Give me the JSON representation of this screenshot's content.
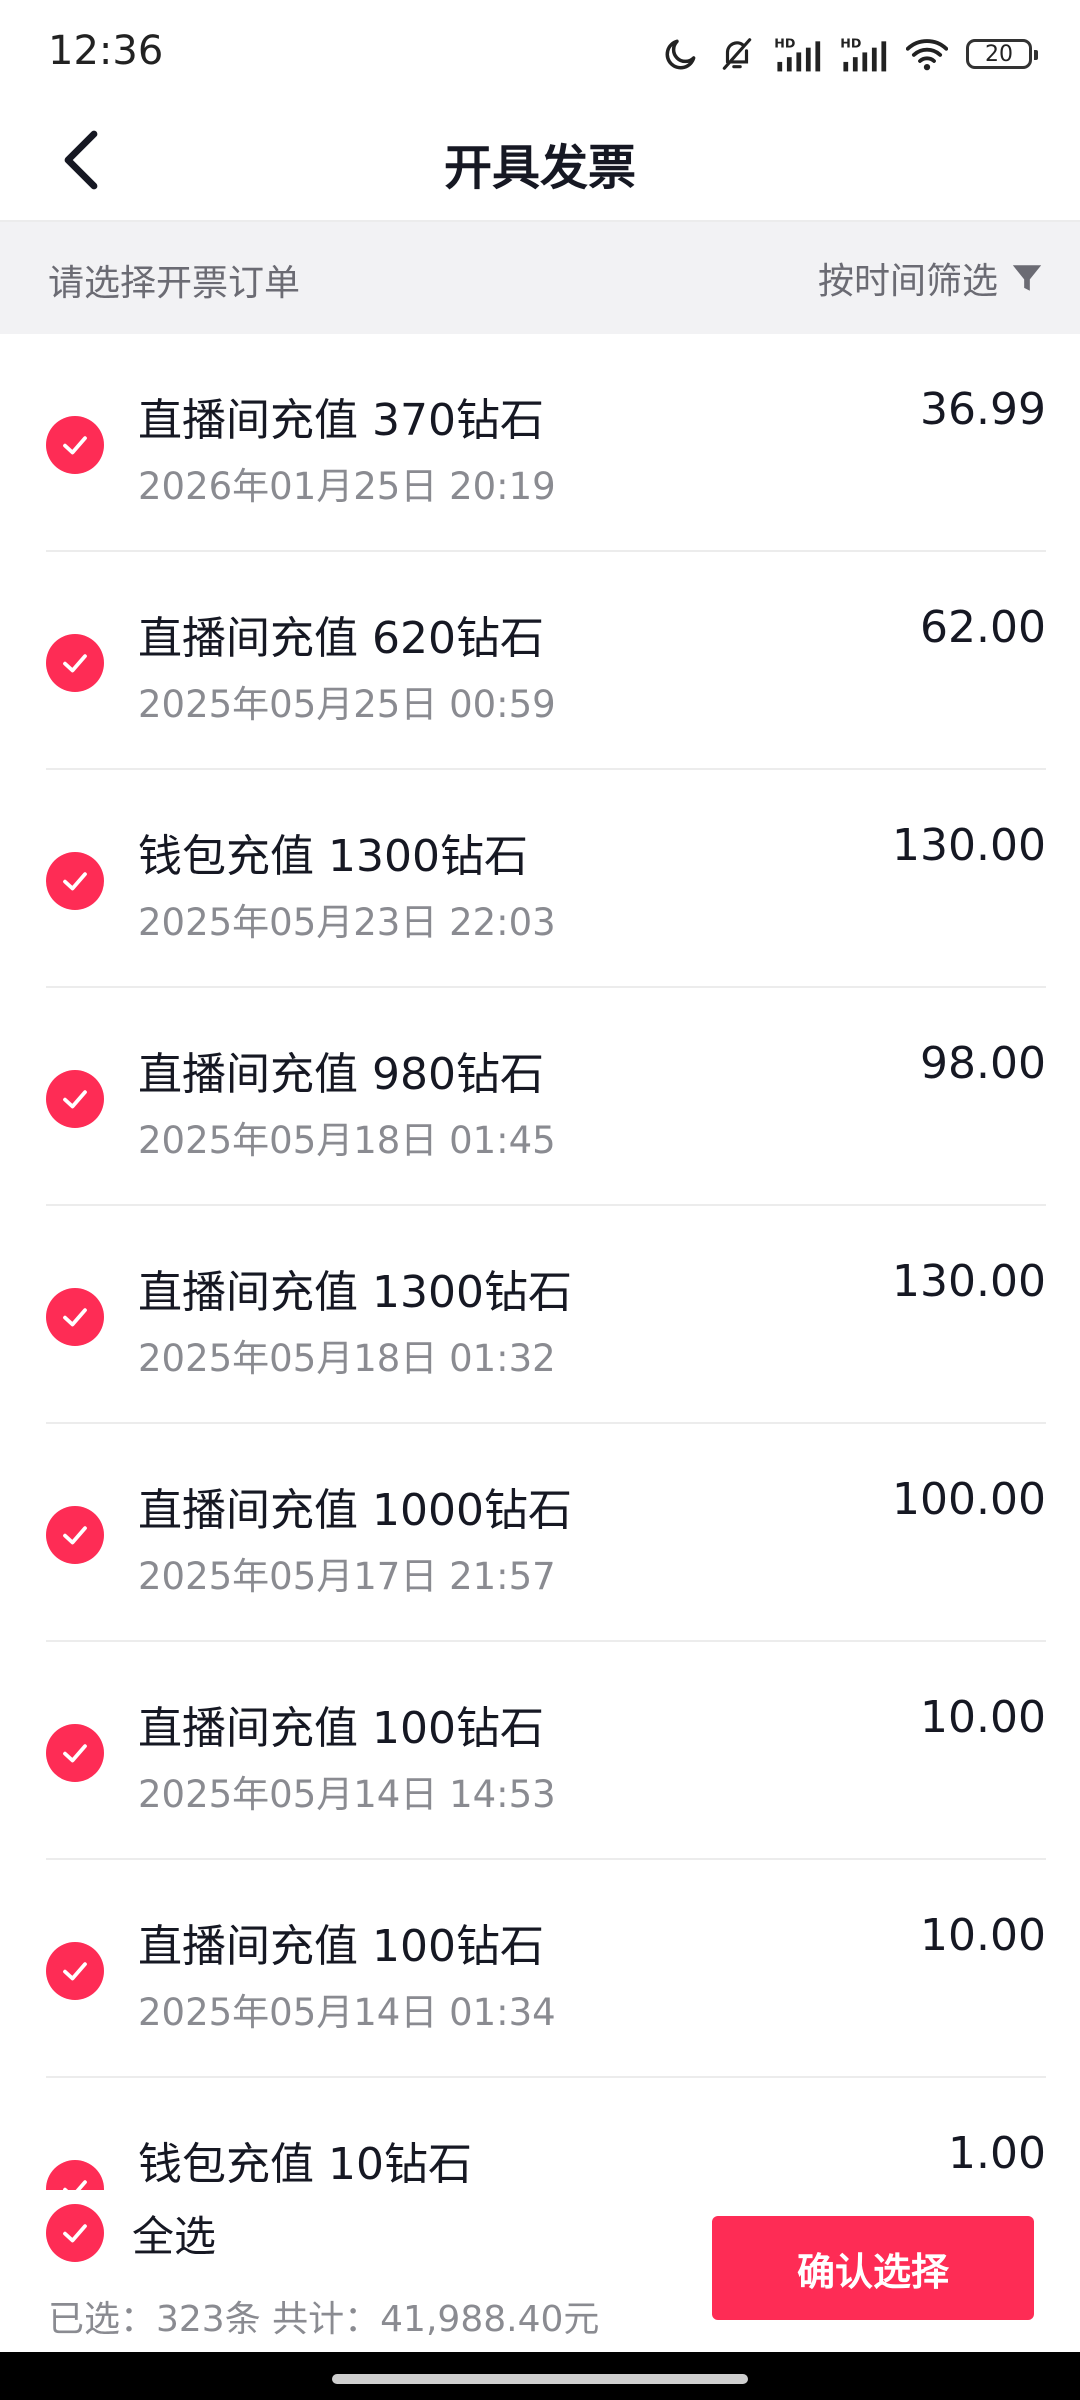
{
  "status_bar": {
    "time": "12:36",
    "battery": "20",
    "icons": [
      "moon-icon",
      "bell-muted-icon",
      "hd-signal-icon",
      "hd-signal-icon",
      "wifi-icon",
      "battery-icon"
    ]
  },
  "nav": {
    "title": "开具发票",
    "back_icon": "chevron-left-icon"
  },
  "filter": {
    "hint": "请选择开票订单",
    "button_label": "按时间筛选",
    "icon": "funnel-icon"
  },
  "orders": [
    {
      "title": "直播间充值 370钻石",
      "date": "2026年01月25日 20:19",
      "amount": "36.99",
      "selected": true
    },
    {
      "title": "直播间充值 620钻石",
      "date": "2025年05月25日 00:59",
      "amount": "62.00",
      "selected": true
    },
    {
      "title": "钱包充值 1300钻石",
      "date": "2025年05月23日 22:03",
      "amount": "130.00",
      "selected": true
    },
    {
      "title": "直播间充值 980钻石",
      "date": "2025年05月18日 01:45",
      "amount": "98.00",
      "selected": true
    },
    {
      "title": "直播间充值 1300钻石",
      "date": "2025年05月18日 01:32",
      "amount": "130.00",
      "selected": true
    },
    {
      "title": "直播间充值 1000钻石",
      "date": "2025年05月17日 21:57",
      "amount": "100.00",
      "selected": true
    },
    {
      "title": "直播间充值 100钻石",
      "date": "2025年05月14日 14:53",
      "amount": "10.00",
      "selected": true
    },
    {
      "title": "直播间充值 100钻石",
      "date": "2025年05月14日 01:34",
      "amount": "10.00",
      "selected": true
    },
    {
      "title": "钱包充值 10钻石",
      "date": "",
      "amount": "1.00",
      "selected": true
    }
  ],
  "bottom": {
    "select_all_label": "全选",
    "summary": "已选：323条 共计：41,988.40元",
    "confirm_label": "确认选择"
  },
  "colors": {
    "accent": "#fe2c55",
    "filter_bg": "#f2f2f4",
    "secondary_text": "#8a8b91"
  }
}
